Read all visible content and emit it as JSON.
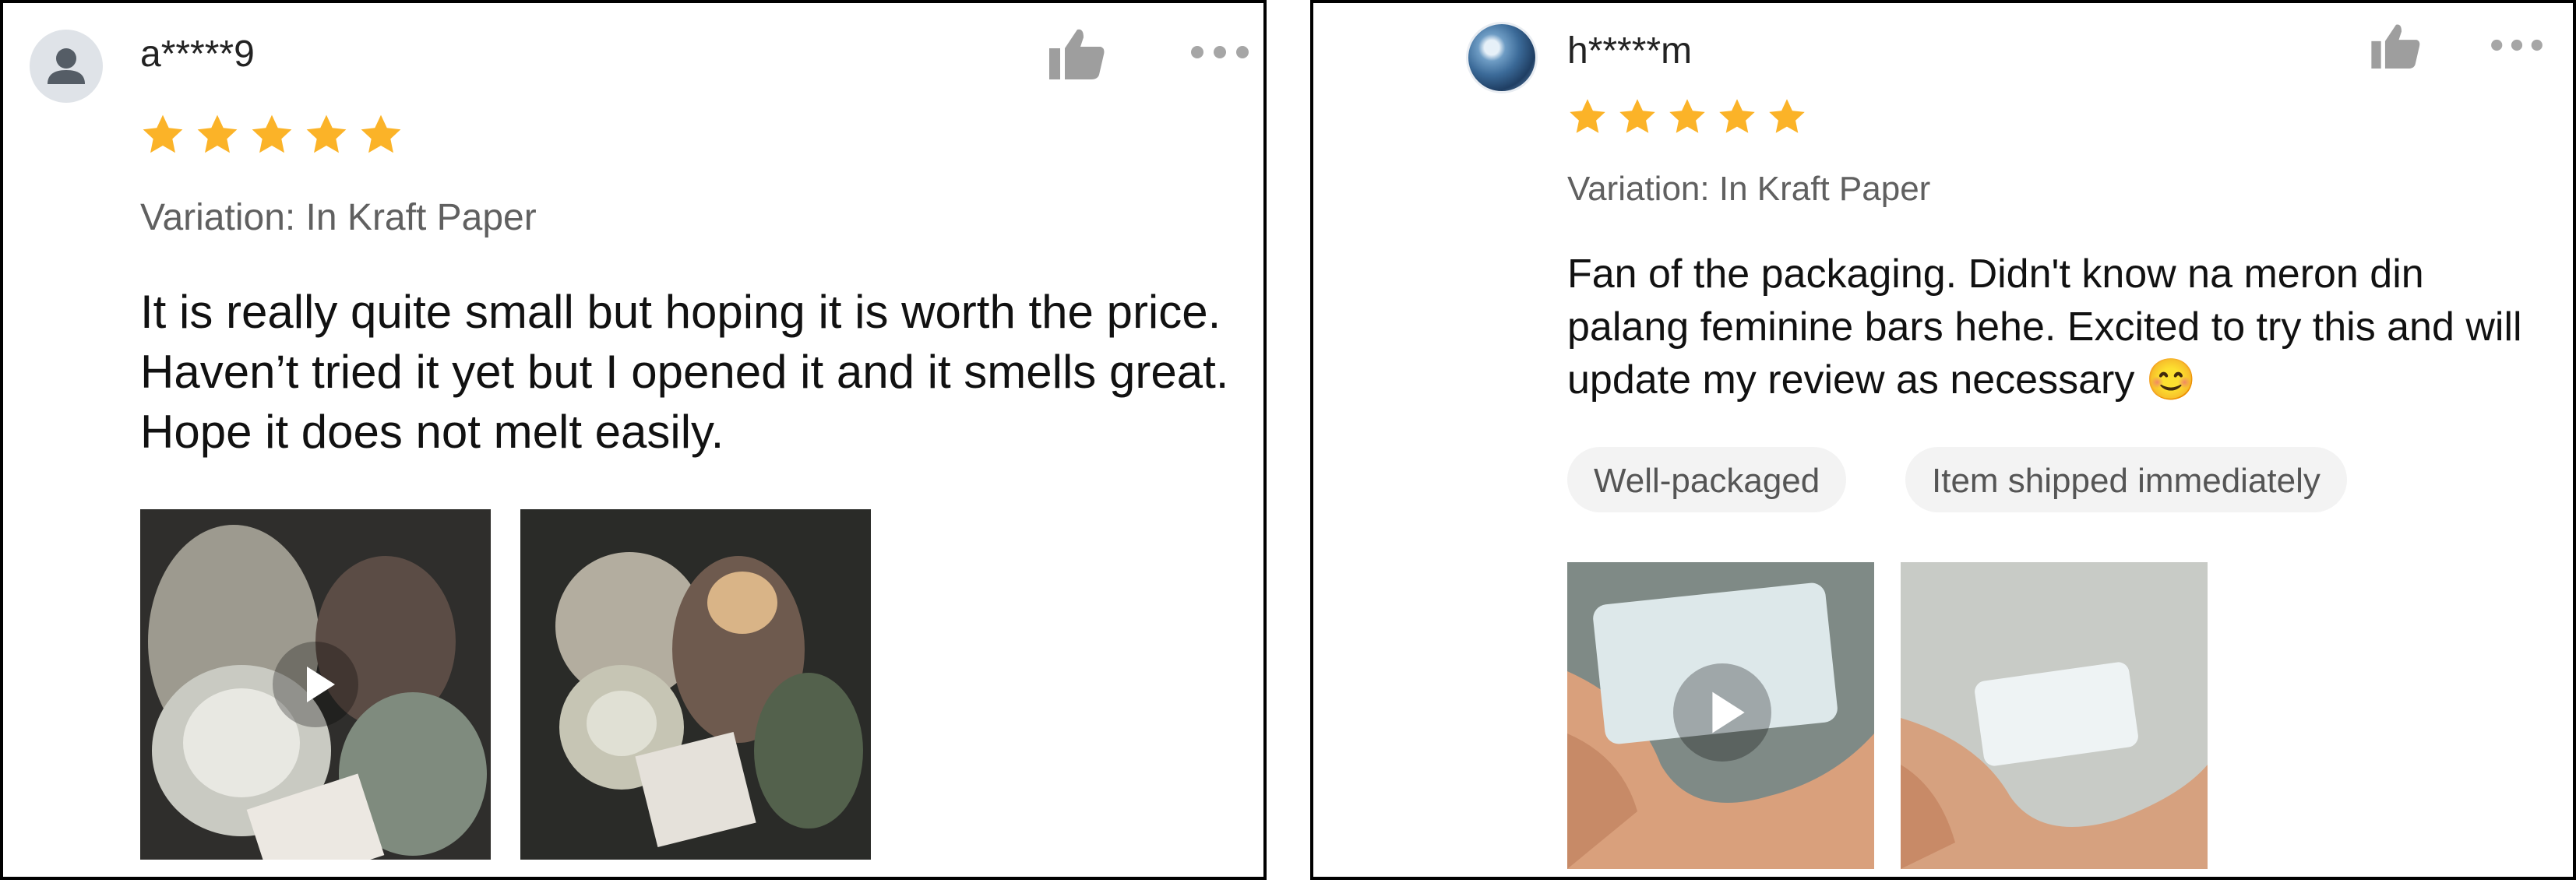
{
  "reviews": [
    {
      "username": "a*****9",
      "avatar": "default-user-icon",
      "rating": 5,
      "variation": "Variation: In Kraft Paper",
      "text": "It is really quite small but hoping it is worth the price. Haven’t tried it yet but I opened it and it smells great. Hope it does not melt easily.",
      "tags": [],
      "media": [
        {
          "type": "video",
          "icon": "play-icon"
        },
        {
          "type": "image"
        }
      ]
    },
    {
      "username": "h*****m",
      "avatar": "photo-avatar",
      "rating": 5,
      "variation": "Variation: In Kraft Paper",
      "text": "Fan of the packaging. Didn't know na meron din palang feminine bars hehe. Excited to try this and will update my review as necessary 😊",
      "tags": [
        "Well-packaged",
        "Item shipped immediately"
      ],
      "media": [
        {
          "type": "video",
          "icon": "play-icon"
        },
        {
          "type": "image"
        }
      ]
    }
  ],
  "icons": {
    "like": "thumbs-up-icon",
    "more": "more-options-icon",
    "star": "star-icon"
  },
  "colors": {
    "star": "#FBB328",
    "icon_gray": "#9e9e9e",
    "tag_bg": "#F3F3F3",
    "variation_text": "#606060"
  }
}
